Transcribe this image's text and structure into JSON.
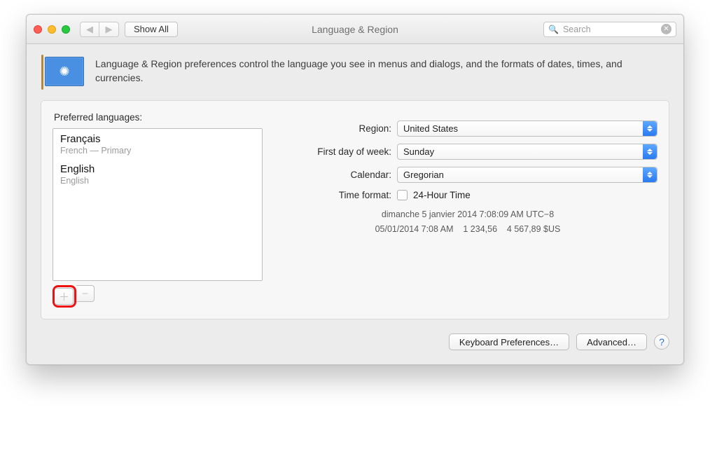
{
  "titlebar": {
    "show_all": "Show All",
    "title": "Language & Region",
    "search_placeholder": "Search"
  },
  "header": {
    "description": "Language & Region preferences control the language you see in menus and dialogs, and the formats of dates, times, and currencies."
  },
  "left": {
    "label": "Preferred languages:",
    "languages": [
      {
        "name": "Français",
        "sub": "French — Primary"
      },
      {
        "name": "English",
        "sub": "English"
      }
    ]
  },
  "right": {
    "region_label": "Region:",
    "region_value": "United States",
    "firstday_label": "First day of week:",
    "firstday_value": "Sunday",
    "calendar_label": "Calendar:",
    "calendar_value": "Gregorian",
    "timefmt_label": "Time format:",
    "timefmt_check": "24-Hour Time",
    "sample_line1": "dimanche 5 janvier 2014 7:08:09 AM UTC−8",
    "sample_line2": "05/01/2014 7:08 AM    1 234,56    4 567,89 $US"
  },
  "footer": {
    "keyboard": "Keyboard Preferences…",
    "advanced": "Advanced…"
  }
}
